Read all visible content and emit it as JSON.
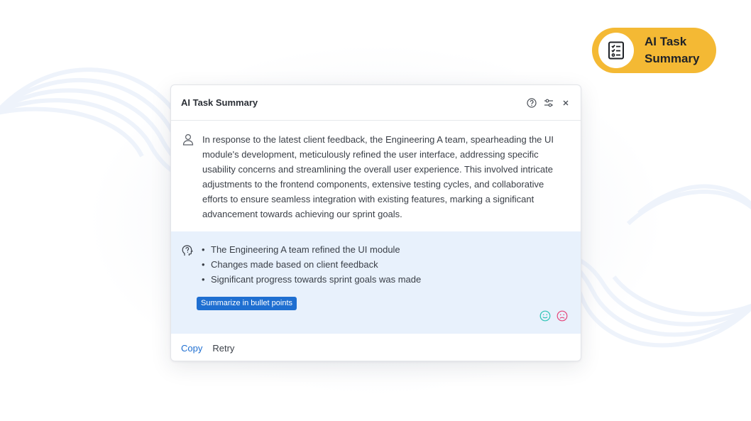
{
  "badge": {
    "label": "AI Task Summary",
    "icon": "checklist-icon",
    "color": "#f4b934"
  },
  "dialog": {
    "title": "AI Task Summary",
    "header_icons": [
      "help-icon",
      "settings-sliders-icon",
      "close-icon"
    ],
    "prompt": {
      "icon": "user-icon",
      "text": "In response to the latest client feedback, the Engineering A team, spearheading the UI module's development, meticulously refined the user interface, addressing specific usability concerns and streamlining the overall user experience. This involved intricate adjustments to the frontend components, extensive testing cycles, and collaborative efforts to ensure seamless integration with existing features, marking a significant advancement towards achieving our sprint goals."
    },
    "response": {
      "icon": "ai-head-icon",
      "bullets": [
        "The Engineering A team refined the UI module",
        "Changes made based on client feedback",
        "Significant progress towards sprint goals was made"
      ],
      "chip_label": "Summarize in bullet points",
      "feedback_icons": [
        "smile-icon",
        "frown-icon"
      ],
      "background": "#e8f1fc"
    },
    "footer": {
      "copy_label": "Copy",
      "retry_label": "Retry"
    }
  },
  "colors": {
    "accent": "#1f6fd1",
    "positive": "#2ec4b6",
    "negative": "#e5457a"
  }
}
